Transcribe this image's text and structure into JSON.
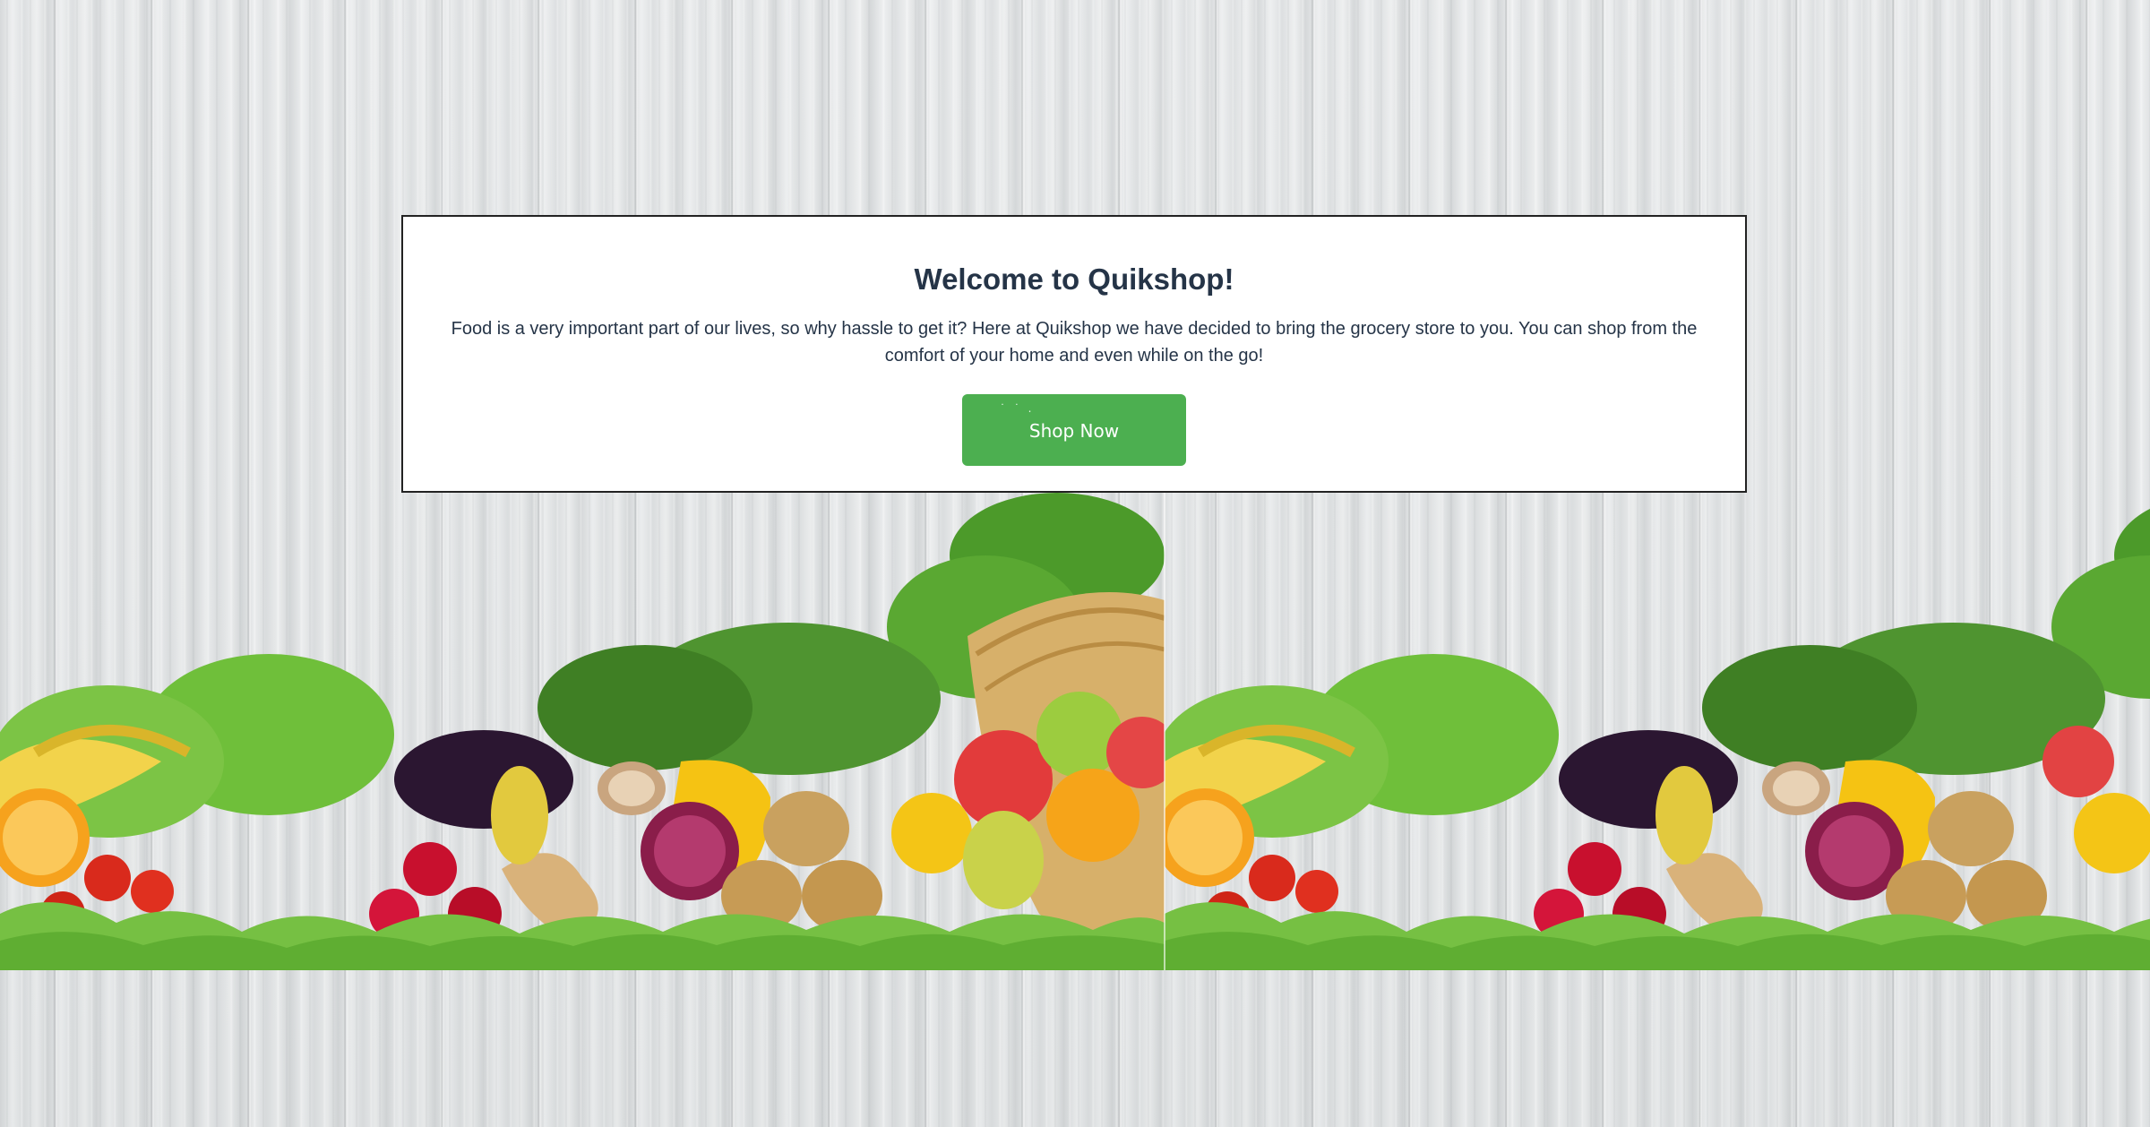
{
  "welcome": {
    "title": "Welcome to Quikshop!",
    "text": "Food is a very important part of our lives, so why hassle to get it? Here at Quikshop we have decided to bring the grocery store to you. You can shop from the comfort of your home and even while on the go!",
    "button_label": "Shop Now"
  },
  "colors": {
    "button": "#4caf50",
    "title_text": "#253447",
    "card_bg": "#ffffff"
  },
  "background": {
    "image": "wood-planks-with-vegetables-and-fruits"
  }
}
